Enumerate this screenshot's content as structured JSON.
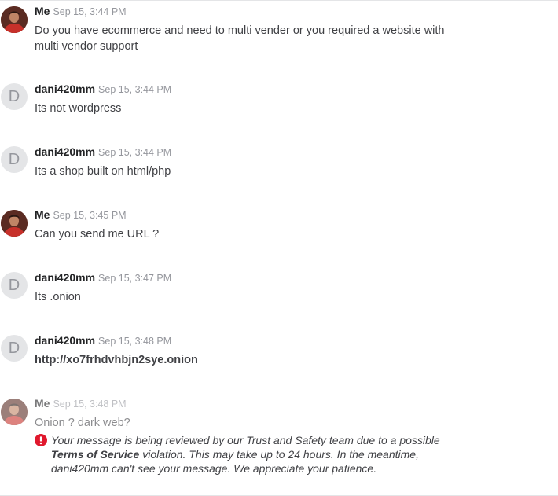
{
  "messages": [
    {
      "sender": "Me",
      "time": "Sep 15, 3:44 PM",
      "text": "Do you have ecommerce and need to multi vender or you required a website with multi vendor support"
    },
    {
      "sender": "dani420mm",
      "avatar_letter": "D",
      "time": "Sep 15, 3:44 PM",
      "text": "Its not wordpress"
    },
    {
      "sender": "dani420mm",
      "avatar_letter": "D",
      "time": "Sep 15, 3:44 PM",
      "text": "Its a shop built on html/php"
    },
    {
      "sender": "Me",
      "time": "Sep 15, 3:45 PM",
      "text": "Can you send me URL ?"
    },
    {
      "sender": "dani420mm",
      "avatar_letter": "D",
      "time": "Sep 15, 3:47 PM",
      "text": "Its .onion"
    },
    {
      "sender": "dani420mm",
      "avatar_letter": "D",
      "time": "Sep 15, 3:48 PM",
      "text": "http://xo7frhdvhbjn2sye.onion"
    },
    {
      "sender": "Me",
      "time": "Sep 15, 3:48 PM",
      "text": "Onion ? dark web?"
    }
  ],
  "review_notice": {
    "before": "Your message is being reviewed by our Trust and Safety team due to a possible ",
    "emphasis": "Terms of Service",
    "after": " violation. This may take up to 24 hours. In the meantime, dani420mm can't see your message. We appreciate your patience."
  },
  "colors": {
    "sender": "#222325",
    "body_text": "#404145",
    "timestamp": "#95979d",
    "letter_avatar_bg": "#e4e5e7",
    "warning": "#e0182d"
  },
  "icons": {
    "warning": "exclamation-circle-icon"
  }
}
